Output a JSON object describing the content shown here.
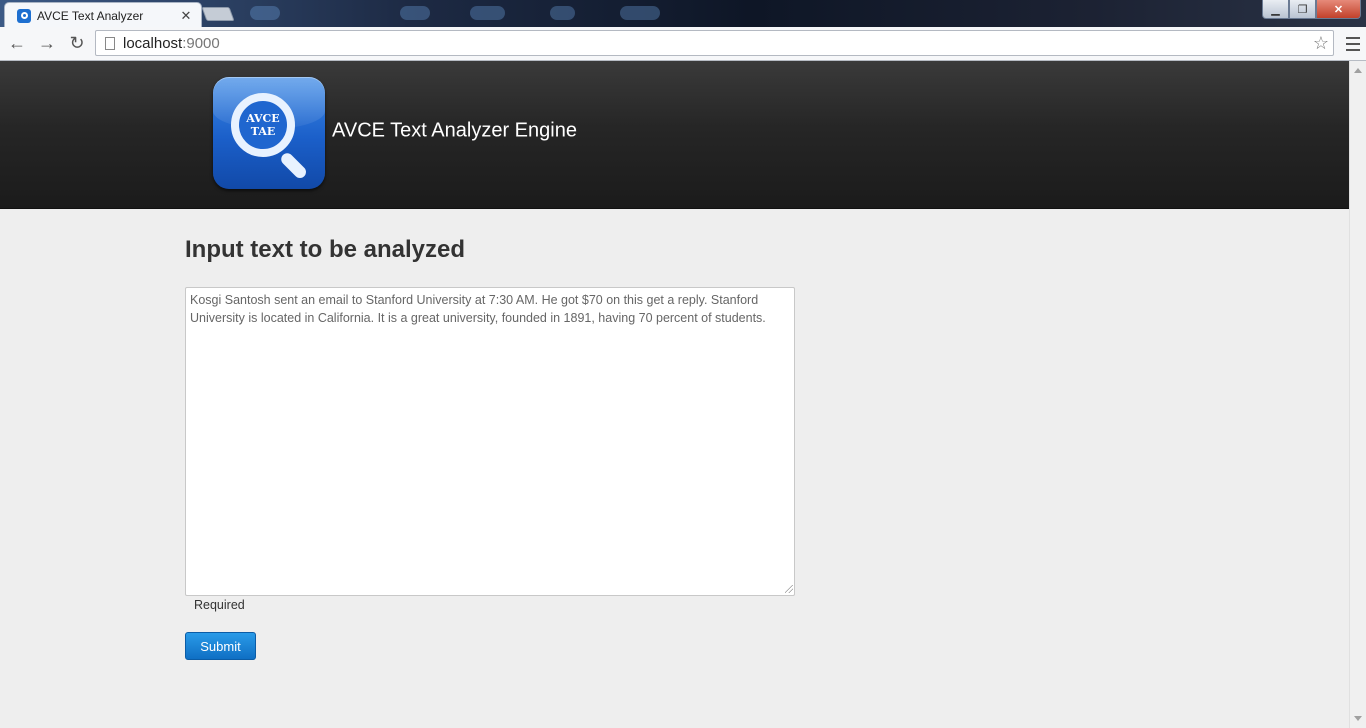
{
  "browser": {
    "tab_title": "AVCE Text Analyzer",
    "tab_close": "✕",
    "url_host": "localhost",
    "url_port": ":9000",
    "window_buttons": {
      "minimize": "▁",
      "maximize": "❐",
      "close": "✕"
    },
    "nav": {
      "back": "←",
      "forward": "→",
      "reload": "↻"
    },
    "star": "☆"
  },
  "header": {
    "logo_line1": "AVCE",
    "logo_line2": "TAE",
    "brand": "AVCE Text Analyzer Engine"
  },
  "form": {
    "heading": "Input text to be analyzed",
    "textarea_value": "Kosgi Santosh sent an email to Stanford University at 7:30 AM. He got $70 on this get a reply. Stanford University is located in California. It is a great university, founded in 1891, having 70 percent of students.",
    "required_label": "Required",
    "submit_label": "Submit"
  },
  "colors": {
    "accent": "#1479d2",
    "header_bg": "#262626",
    "page_bg": "#eeeeee"
  }
}
